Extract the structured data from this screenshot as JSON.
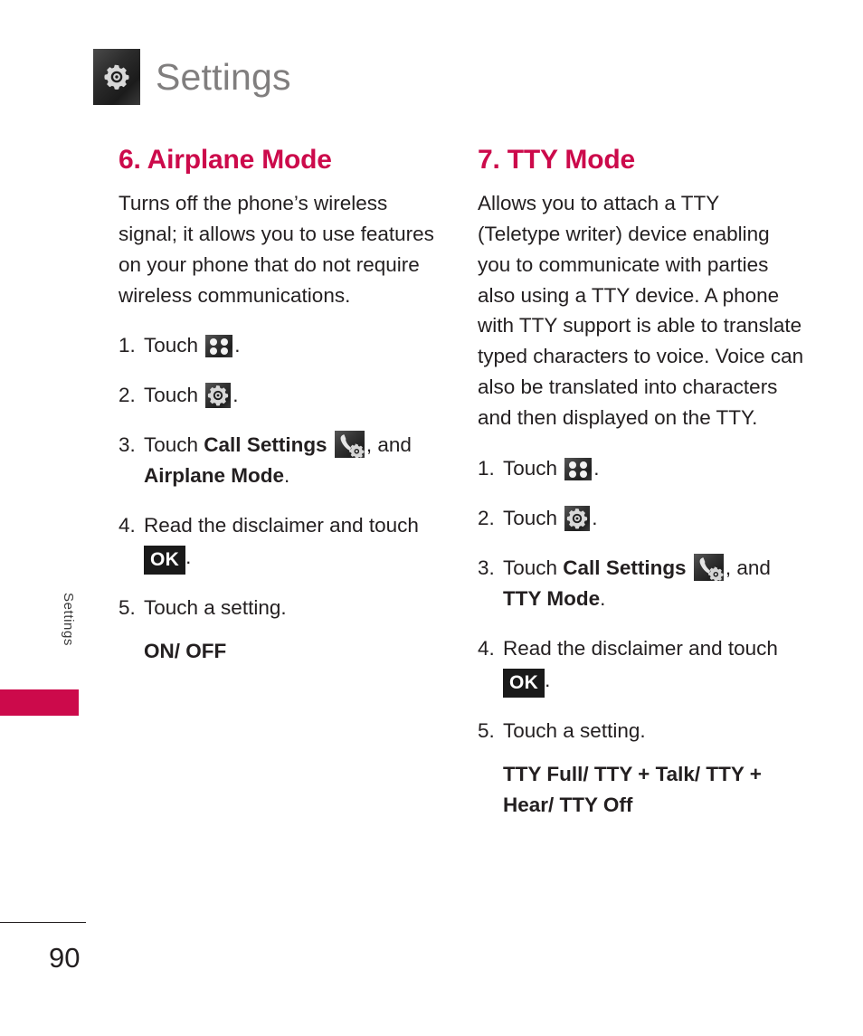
{
  "header": {
    "title": "Settings",
    "icon": "gear-icon"
  },
  "side_tab": {
    "label": "Settings"
  },
  "footer": {
    "page_number": "90"
  },
  "colors": {
    "accent": "#CC0A4B",
    "header_text": "#807E7E",
    "body_text": "#231F20",
    "badge_bg": "#1A1A1A"
  },
  "sections": [
    {
      "heading": "6. Airplane Mode",
      "body": "Turns off the phone’s wireless signal; it allows you to use features on your phone that do not require wireless communications.",
      "steps": [
        {
          "num": "1.",
          "pre": "Touch ",
          "icon": "grid-menu-icon",
          "post": "."
        },
        {
          "num": "2.",
          "pre": "Touch ",
          "icon": "gear-icon",
          "post": "."
        },
        {
          "num": "3.",
          "pre": "Touch ",
          "bold1": "Call Settings",
          "icon": "call-settings-icon",
          "mid": ", and ",
          "bold2": "Airplane Mode",
          "post": "."
        },
        {
          "num": "4.",
          "pre": "Read the disclaimer and touch ",
          "badge": "OK",
          "post": "."
        },
        {
          "num": "5.",
          "pre": "Touch a setting.",
          "post": ""
        }
      ],
      "setting_values": "ON/ OFF"
    },
    {
      "heading": "7. TTY Mode",
      "body": "Allows you to attach a TTY (Teletype writer) device enabling you to communicate with parties also using a TTY device. A phone with TTY support is able to translate typed characters to voice. Voice can also be translated into characters and then displayed on the TTY.",
      "steps": [
        {
          "num": "1.",
          "pre": "Touch ",
          "icon": "grid-menu-icon",
          "post": "."
        },
        {
          "num": "2.",
          "pre": "Touch ",
          "icon": "gear-icon",
          "post": "."
        },
        {
          "num": "3.",
          "pre": "Touch ",
          "bold1": "Call Settings",
          "icon": "call-settings-icon",
          "mid": ", and ",
          "bold2": "TTY Mode",
          "post": "."
        },
        {
          "num": "4.",
          "pre": "Read the disclaimer and touch ",
          "badge": "OK",
          "post": "."
        },
        {
          "num": "5.",
          "pre": "Touch a setting.",
          "post": ""
        }
      ],
      "setting_values": "TTY Full/ TTY + Talk/ TTY + Hear/ TTY Off"
    }
  ]
}
